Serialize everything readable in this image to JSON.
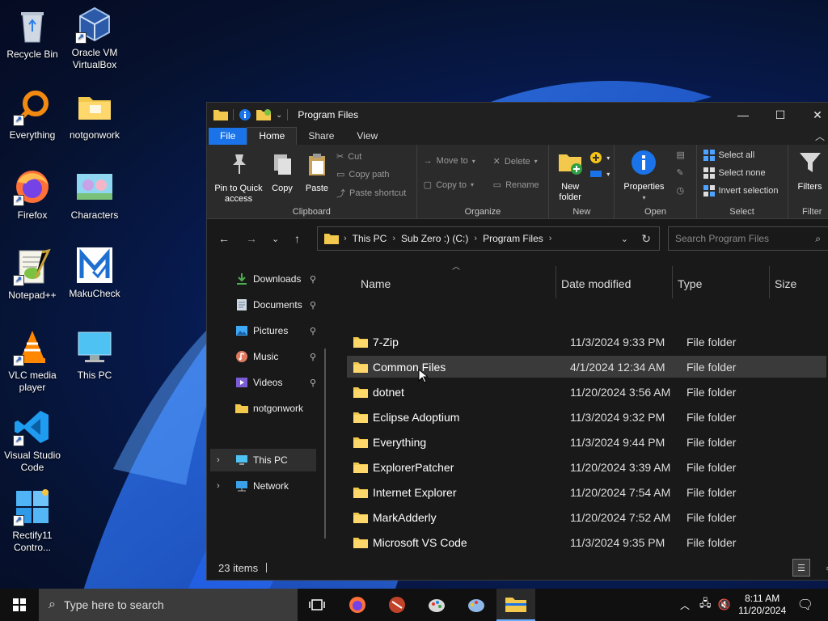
{
  "desktop": {
    "icons": [
      {
        "label": "Recycle Bin",
        "icon": "recycle-bin-icon"
      },
      {
        "label": "Oracle VM VirtualBox",
        "icon": "virtualbox-icon"
      },
      {
        "label": "Everything",
        "icon": "everything-search-icon"
      },
      {
        "label": "notgonwork",
        "icon": "folder-icon"
      },
      {
        "label": "Firefox",
        "icon": "firefox-icon"
      },
      {
        "label": "Characters",
        "icon": "characters-image-icon"
      },
      {
        "label": "Notepad++",
        "icon": "notepadpp-icon"
      },
      {
        "label": "MakuCheck",
        "icon": "makucheck-icon"
      },
      {
        "label": "VLC media player",
        "icon": "vlc-icon"
      },
      {
        "label": "This PC",
        "icon": "this-pc-icon"
      },
      {
        "label": "Visual Studio Code",
        "icon": "vscode-icon"
      },
      {
        "label": "Rectify11 Contro...",
        "icon": "rectify11-icon"
      }
    ]
  },
  "window": {
    "title": "Program Files",
    "controls": {
      "minimize": "—",
      "maximize": "☐",
      "close": "✕"
    },
    "tabs": [
      "File",
      "Home",
      "Share",
      "View"
    ],
    "active_tab": "Home"
  },
  "ribbon": {
    "clipboard": {
      "label": "Clipboard",
      "pin": "Pin to Quick access",
      "copy": "Copy",
      "paste": "Paste",
      "cut": "Cut",
      "copy_path": "Copy path",
      "paste_shortcut": "Paste shortcut"
    },
    "organize": {
      "label": "Organize",
      "move_to": "Move to",
      "copy_to": "Copy to",
      "delete": "Delete",
      "rename": "Rename"
    },
    "new": {
      "label": "New",
      "new_folder": "New folder"
    },
    "open": {
      "label": "Open",
      "properties": "Properties"
    },
    "select": {
      "label": "Select",
      "select_all": "Select all",
      "select_none": "Select none",
      "invert": "Invert selection"
    },
    "filter": {
      "label": "Filter",
      "filters": "Filters"
    }
  },
  "address": {
    "crumbs": [
      "This PC",
      "Sub Zero :) (C:)",
      "Program Files"
    ],
    "search_placeholder": "Search Program Files"
  },
  "nav": {
    "items": [
      {
        "label": "Downloads",
        "icon": "download-icon",
        "pinned": true
      },
      {
        "label": "Documents",
        "icon": "documents-icon",
        "pinned": true
      },
      {
        "label": "Pictures",
        "icon": "pictures-icon",
        "pinned": true
      },
      {
        "label": "Music",
        "icon": "music-icon",
        "pinned": true
      },
      {
        "label": "Videos",
        "icon": "videos-icon",
        "pinned": true
      },
      {
        "label": "notgonwork",
        "icon": "folder-icon",
        "pinned": false
      },
      {
        "label": "This PC",
        "icon": "this-pc-icon",
        "pinned": false,
        "selected": true
      },
      {
        "label": "Network",
        "icon": "network-icon",
        "pinned": false
      }
    ],
    "pin_glyph": "📌"
  },
  "files": {
    "columns": [
      "Name",
      "Date modified",
      "Type",
      "Size"
    ],
    "rows": [
      {
        "name": "7-Zip",
        "date": "11/3/2024 9:33 PM",
        "type": "File folder"
      },
      {
        "name": "Common Files",
        "date": "4/1/2024 12:34 AM",
        "type": "File folder"
      },
      {
        "name": "dotnet",
        "date": "11/20/2024 3:56 AM",
        "type": "File folder"
      },
      {
        "name": "Eclipse Adoptium",
        "date": "11/3/2024 9:32 PM",
        "type": "File folder"
      },
      {
        "name": "Everything",
        "date": "11/3/2024 9:44 PM",
        "type": "File folder"
      },
      {
        "name": "ExplorerPatcher",
        "date": "11/20/2024 3:39 AM",
        "type": "File folder"
      },
      {
        "name": "Internet Explorer",
        "date": "11/20/2024 7:54 AM",
        "type": "File folder"
      },
      {
        "name": "MarkAdderly",
        "date": "11/20/2024 7:52 AM",
        "type": "File folder"
      },
      {
        "name": "Microsoft VS Code",
        "date": "11/3/2024 9:35 PM",
        "type": "File folder"
      }
    ],
    "hovered_row": "Common Files"
  },
  "status": {
    "count": "23 items"
  },
  "taskbar": {
    "search_placeholder": "Type here to search",
    "time": "8:11 AM",
    "date": "11/20/2024"
  },
  "colors": {
    "accent": "#1a73e8",
    "folder": "#f2c94c",
    "window_bg": "#191919",
    "ribbon_bg": "#2b2b2b"
  }
}
